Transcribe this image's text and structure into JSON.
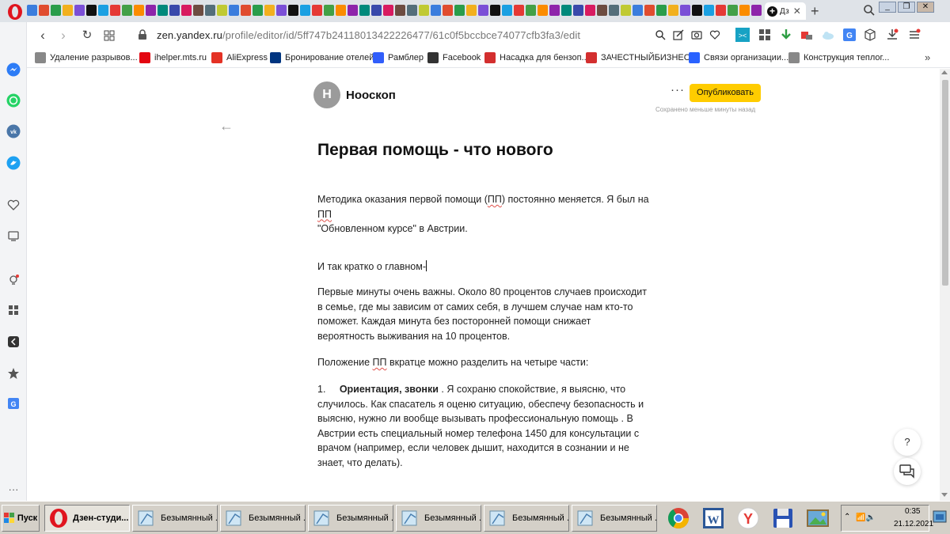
{
  "browser": {
    "active_tab_label": "Дз",
    "url_host": "zen.yandex.ru",
    "url_path": "/profile/editor/id/5ff747b24118013422226477/61c0f5bccbce74077cfb3fa3/edit",
    "tab_icon_colors": [
      "#3b7ddd",
      "#e04c2f",
      "#2a9d4b",
      "#f2b01e",
      "#7b4fd6",
      "#111111",
      "#1ba0e2",
      "#e53935",
      "#43a047",
      "#fb8c00",
      "#8e24aa",
      "#00897b",
      "#3949ab",
      "#d81b60",
      "#6d4c41",
      "#546e7a",
      "#c0ca33",
      "#3b7ddd",
      "#e04c2f",
      "#2a9d4b",
      "#f2b01e",
      "#7b4fd6",
      "#111111",
      "#1ba0e2",
      "#e53935",
      "#43a047",
      "#fb8c00",
      "#8e24aa",
      "#00897b",
      "#3949ab",
      "#d81b60",
      "#6d4c41",
      "#546e7a",
      "#c0ca33",
      "#3b7ddd",
      "#e04c2f",
      "#2a9d4b",
      "#f2b01e",
      "#7b4fd6",
      "#111111",
      "#1ba0e2",
      "#e53935",
      "#43a047",
      "#fb8c00",
      "#8e24aa",
      "#00897b",
      "#3949ab",
      "#d81b60",
      "#6d4c41",
      "#546e7a",
      "#c0ca33",
      "#3b7ddd",
      "#e04c2f",
      "#2a9d4b",
      "#f2b01e",
      "#7b4fd6",
      "#111111",
      "#1ba0e2",
      "#e53935",
      "#43a047",
      "#fb8c00",
      "#8e24aa",
      "#00897b",
      "#3949ab"
    ]
  },
  "bookmarks": [
    {
      "label": "Удаление разрывов...",
      "icon": "grid-icon",
      "color": "#888888"
    },
    {
      "label": "ihelper.mts.ru",
      "icon": "mts-icon",
      "color": "#e30611"
    },
    {
      "label": "AliExpress",
      "icon": "aliexpress-icon",
      "color": "#e43225"
    },
    {
      "label": "Бронирование отелей",
      "icon": "booking-icon",
      "color": "#003580"
    },
    {
      "label": "Рамблер",
      "icon": "rambler-icon",
      "color": "#315efb"
    },
    {
      "label": "Facebook",
      "icon": "bookmark-icon",
      "color": "#333333"
    },
    {
      "label": "Насадка для бензоп...",
      "icon": "pin-icon",
      "color": "#d32f2f"
    },
    {
      "label": "ЗАЧЕСТНЫЙБИЗНЕС...",
      "icon": "za-icon",
      "color": "#d32f2f"
    },
    {
      "label": "Связи организации...",
      "icon": "list-org-icon",
      "color": "#2962ff"
    },
    {
      "label": "Конструкция теплог...",
      "icon": "link-icon",
      "color": "#888888"
    }
  ],
  "editor": {
    "avatar_letter": "Н",
    "channel_name": "Нооскоп",
    "more_label": "···",
    "publish_label": "Опубликовать",
    "saved_status": "Сохранено меньше минуты назад",
    "back_label": "←"
  },
  "article": {
    "title": "Первая помощь - что нового",
    "p1_a": "Методика оказания первой помощи (",
    "p1_pp": "ПП",
    "p1_b": ") постоянно меняется. Я был на ",
    "p1_pp2": "ПП",
    "p1_c": "\"Обновленном курсе\" в Австрии.",
    "p2": "И так кратко о главном-",
    "p3": "Первые минуты очень важны. Около 80 процентов случаев происходит в семье, где мы зависим от самих себя, в лучшем случае нам кто-то поможет. Каждая минута без посторонней помощи снижает вероятность выживания на 10 процентов.",
    "p4_a": "Положение ",
    "p4_pp": "ПП",
    "p4_b": " вкратце можно разделить на четыре части:",
    "li1_num": "1.",
    "li1_bold": "Ориентация, звонки",
    "li1_text": " . Я сохраню спокойствие, я выясню, что случилось. Как спасатель я оценю ситуацию, обеспечу безопасность и выясню, нужно ли вообще вызывать профессиональную помощь . В Австрии есть специальный номер телефона 1450 для консультации с врачом (например, если человек дышит, находится в сознании и не знает, что делать)."
  },
  "help_label": "?",
  "taskbar": {
    "start_label": "Пуск",
    "tasks": [
      {
        "label": "Дзен-студи...",
        "icon": "opera-icon",
        "active": true
      },
      {
        "label": "Безымянный ...",
        "icon": "paint-icon",
        "active": false
      },
      {
        "label": "Безымянный ...",
        "icon": "paint-icon",
        "active": false
      },
      {
        "label": "Безымянный ...",
        "icon": "paint-icon",
        "active": false
      },
      {
        "label": "Безымянный ...",
        "icon": "paint-icon",
        "active": false
      },
      {
        "label": "Безымянный ...",
        "icon": "paint-icon",
        "active": false
      },
      {
        "label": "Безымянный ...",
        "icon": "paint-icon",
        "active": false
      }
    ],
    "time": "0:35",
    "date": "21.12.2021"
  }
}
